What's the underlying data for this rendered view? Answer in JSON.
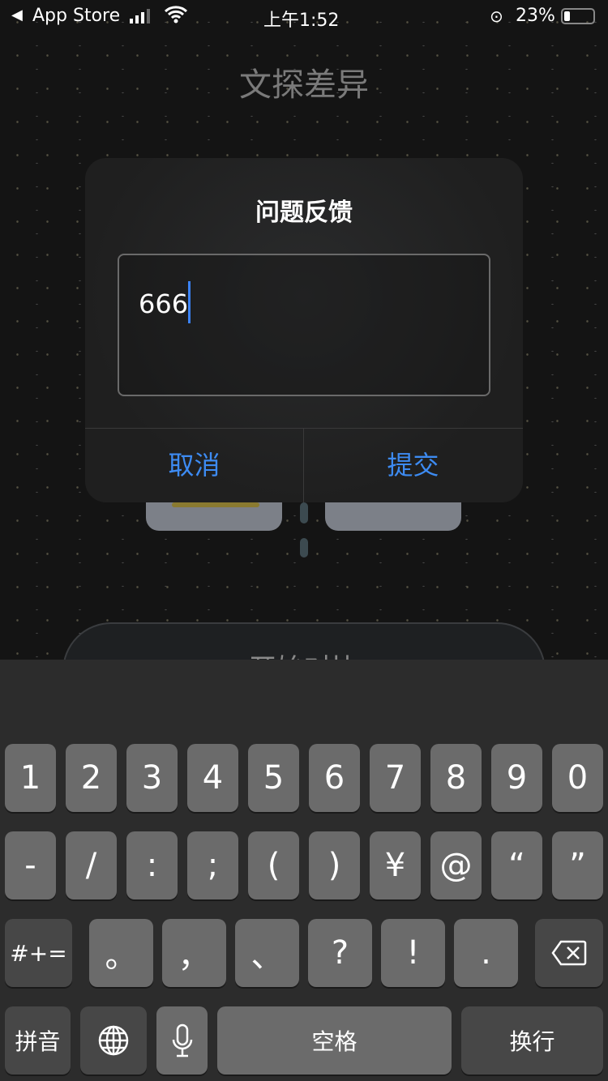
{
  "status": {
    "back_label": "App Store",
    "time": "上午1:52",
    "battery": "23%",
    "battery_level": 0.23
  },
  "app": {
    "title": "文探差异",
    "start_button": "开始对比"
  },
  "dialog": {
    "title": "问题反馈",
    "input_value": "666",
    "cancel": "取消",
    "submit": "提交",
    "accent": "#3d8bf2"
  },
  "keyboard": {
    "row1": [
      "1",
      "2",
      "3",
      "4",
      "5",
      "6",
      "7",
      "8",
      "9",
      "0"
    ],
    "row2": [
      "-",
      "/",
      ":",
      ";",
      "(",
      ")",
      "¥",
      "@",
      "“",
      "”"
    ],
    "row3_left": "#+=",
    "row3": [
      "。",
      "，",
      "、",
      "?",
      "!",
      "."
    ],
    "pinyin": "拼音",
    "space": "空格",
    "return": "换行"
  }
}
